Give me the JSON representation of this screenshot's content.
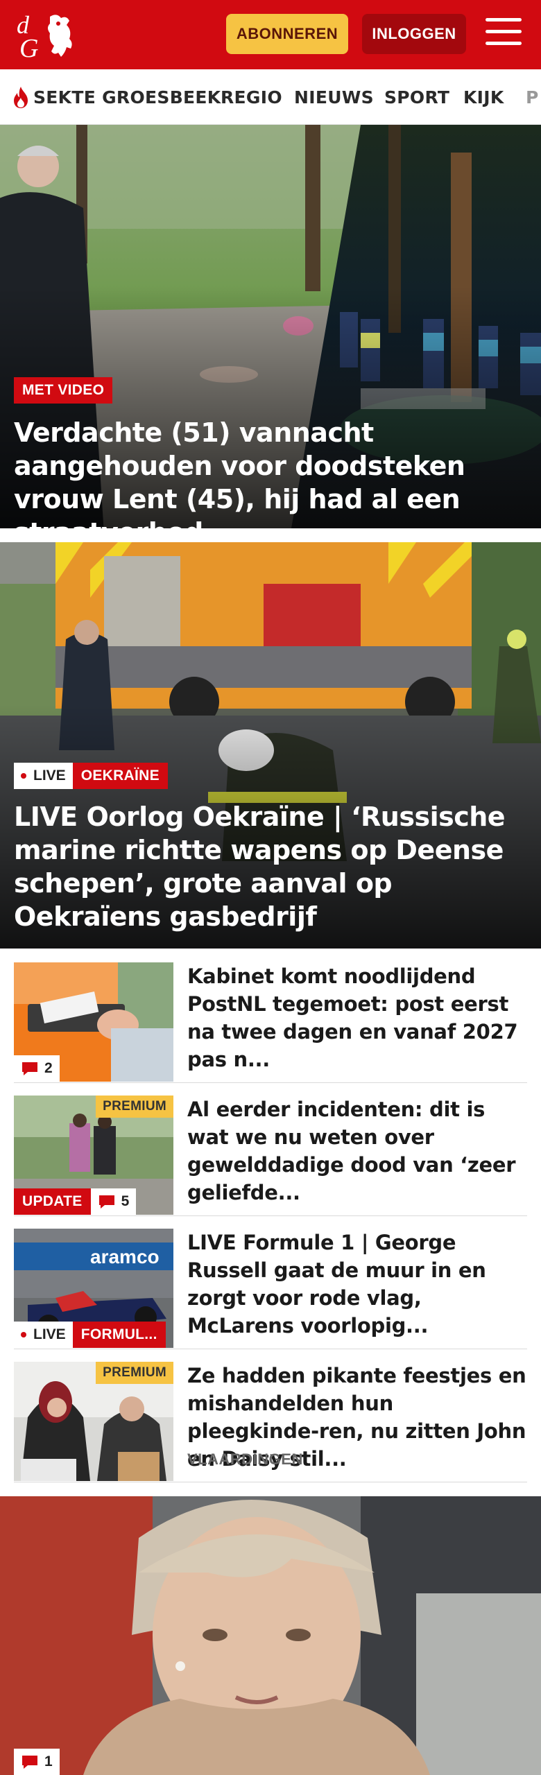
{
  "header": {
    "logo_text": "dG",
    "subscribe_label": "ABONNEREN",
    "login_label": "INLOGGEN",
    "brand_color": "#d10a11"
  },
  "nav": {
    "items": [
      {
        "label": "SEKTE GROESBEEK",
        "icon": "flame-icon"
      },
      {
        "label": "REGIO"
      },
      {
        "label": "NIEUWS"
      },
      {
        "label": "SPORT"
      },
      {
        "label": "KIJK"
      },
      {
        "label": "P"
      }
    ]
  },
  "hero1": {
    "tag": "MET VIDEO",
    "title": "Verdachte (51) vannacht aangehouden voor doodsteken vrouw Lent (45), hij had al een straatverbod"
  },
  "hero2": {
    "live_label": "LIVE",
    "category": "OEKRAÏNE",
    "title": "LIVE Oorlog Oekraïne | ‘Russische marine richtte wapens op Deense schepen’, grote aanval op Oekraïens gasbedrijf"
  },
  "articles": [
    {
      "title": "Kabinet komt noodlijdend PostNL tegemoet: post eerst na twee dagen en vanaf 2027 pas n...",
      "comments": "2"
    },
    {
      "title": "Al eerder incidenten: dit is wat we nu weten over gewelddadige dood van ‘zeer geliefde...",
      "premium": "PREMIUM",
      "update": "UPDATE",
      "comments": "5"
    },
    {
      "title": "LIVE Formule 1 | George Russell gaat de muur in en zorgt voor rode vlag, McLarens voorlopig...",
      "live_label": "LIVE",
      "category": "FORMUL..."
    },
    {
      "title": "Ze hadden pikante feestjes en mishandelden hun pleegkinde-ren, nu zitten John en Daisy stil...",
      "premium": "PREMIUM",
      "location": "VLAARDINGEN"
    }
  ],
  "bottom_hero": {
    "comments": "1"
  }
}
